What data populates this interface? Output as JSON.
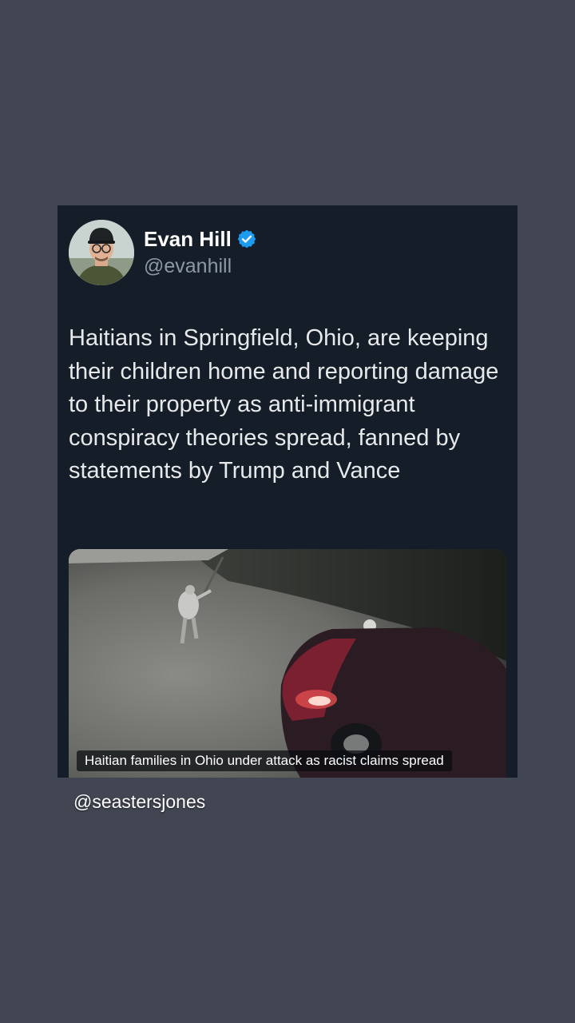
{
  "tweet": {
    "author_name": "Evan Hill",
    "author_handle": "@evanhill",
    "verified": true,
    "verified_color": "#1d9bf0",
    "text": "Haitians in Springfield, Ohio, are keeping their children home and reporting damage to their property as anti-immigrant conspiracy theories spread, fanned by statements by Trump and Vance",
    "media": {
      "caption": "Haitian families in Ohio under attack as racist claims spread"
    }
  },
  "watermark": "@seastersjones",
  "colors": {
    "background": "#414652",
    "card": "#151d28",
    "text": "#e7e9ea",
    "handle": "#8b98a5"
  }
}
